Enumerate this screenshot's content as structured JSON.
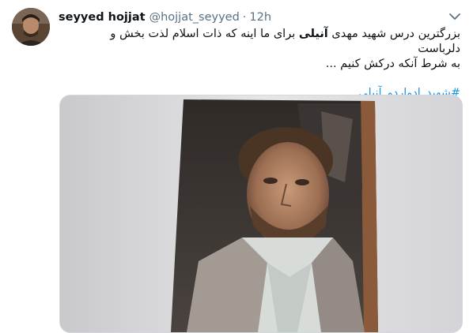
{
  "tweet": {
    "author": {
      "display_name": "seyyed hojjat",
      "handle": "@hojjat_seyyed",
      "separator": "·",
      "time": "12h",
      "avatar_icon": "profile-photo"
    },
    "menu_icon": "chevron-down-icon",
    "text_line1_part1": "بزرگترین درس شهید مهدی ",
    "text_line1_bold": "آنیلی",
    "text_line1_part2": " برای ما اینه که ذات اسلام لذت بخش و دلرباست",
    "text_line2": "به شرط آنکه درکش کنیم ...",
    "hashtag": "#شهید_ادواردو_آنیلی",
    "media_alt": "photo",
    "colors": {
      "link": "#1b95e0",
      "secondary_text": "#5b7083",
      "border": "#cfd9de"
    }
  }
}
